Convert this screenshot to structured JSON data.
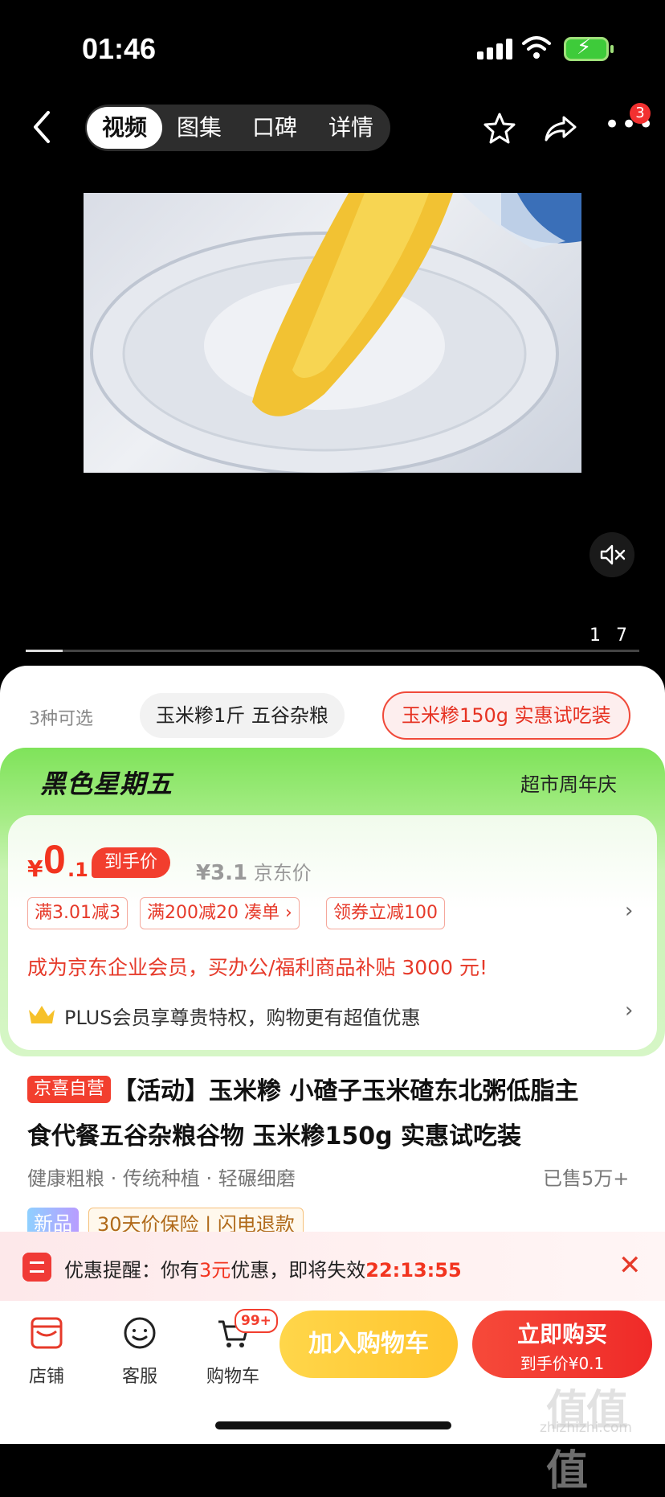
{
  "status": {
    "time": "01:46"
  },
  "nav": {
    "tabs": [
      {
        "label": "视频",
        "active": true
      },
      {
        "label": "图集"
      },
      {
        "label": "口碑"
      },
      {
        "label": "详情"
      }
    ],
    "more_badge": "3"
  },
  "video": {
    "page": "1",
    "total": "7",
    "progress": 0.06
  },
  "variants": {
    "count_label": "3种可选",
    "options": [
      "玉米糁1斤 五谷杂粮",
      "玉米糁150g 实惠试吃装"
    ],
    "selected": "玉米糁150g 实惠试吃装"
  },
  "promo": {
    "title": "黑色星期五",
    "right_label": "超市周年庆",
    "price_symbol": "¥",
    "price_int": "0",
    "price_dec": ".1",
    "price_tag": "到手价",
    "orig_price": "¥3.1",
    "orig_label": "京东价",
    "coupons": [
      "满3.01减3",
      "满200减20  凑单 ›",
      "领券立减100"
    ],
    "enterprise": "成为京东企业会员，买办公/福利商品补贴 3000 元!",
    "plus": "PLUS会员享尊贵特权，购物更有超值优惠"
  },
  "product": {
    "badge": "京喜自营",
    "title_line1": "【活动】玉米糁 小碴子玉米碴东北粥低脂主",
    "title_line2": "食代餐五谷杂粮谷物 玉米糁150g 实惠试吃装",
    "features": "健康粗粮 · 传统种植 · 轻碾细磨",
    "sold": "已售5万+",
    "tag_new": "新品",
    "tag_guarantee": "30天价保险 | 闪电退款"
  },
  "reminder": {
    "prefix": "优惠提醒：你有",
    "amount": "3元",
    "middle": "优惠，即将失效",
    "countdown": "22:13:55"
  },
  "bottom": {
    "store": "店铺",
    "service": "客服",
    "cart": "购物车",
    "cart_badge": "99+",
    "add_cart": "加入购物车",
    "buy_now": "立即购买",
    "buy_now_sub": "到手价¥0.1"
  },
  "watermark": {
    "main": "值值值",
    "sub": "zhizhizhi.com"
  },
  "colors": {
    "accent_red": "#f2341f",
    "promo_green": "#7fe35a",
    "cart_yellow": "#ffc52e"
  }
}
